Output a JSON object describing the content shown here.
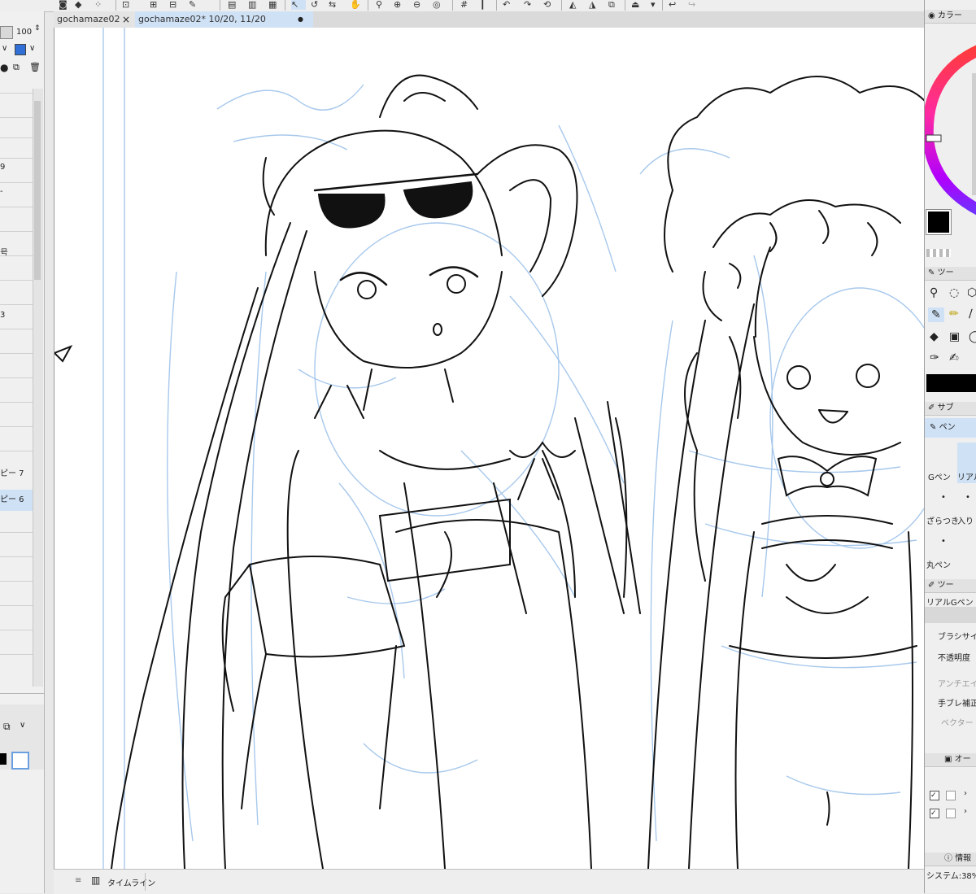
{
  "app": {
    "tabs": [
      {
        "label": "gochamaze02",
        "active": false
      },
      {
        "label": "gochamaze02* 10/20, 11/20",
        "active": true
      }
    ],
    "tab_close_glyph": "×",
    "tab_modified_glyph": "●"
  },
  "left_panel": {
    "opacity_value": "100",
    "layer_numbers": [
      "9",
      "3"
    ],
    "side_glyph": "号",
    "copies": [
      {
        "label": "ピー 7",
        "selected": false
      },
      {
        "label": "ピー 6",
        "selected": true
      }
    ]
  },
  "bottom_bar": {
    "timeline_label": "タイムライン"
  },
  "right_panel": {
    "color_header": "カラー",
    "tool_header": "ツー",
    "sub_header": "サブ",
    "sub_tool_selected": "ペン",
    "brushes": [
      "Gペン",
      "リアル",
      "ざらつき",
      "入り",
      "丸ペン"
    ],
    "tool_property_header": "ツー",
    "tool_name": "リアルGペン",
    "properties": [
      "ブラシサイ",
      "不透明度",
      "アンチエイ",
      "手ブレ補正",
      "ベクター"
    ],
    "auto_header": "オー",
    "info_header": "情報",
    "system_status": "システム:38%"
  },
  "colors": {
    "main_color": "#000000",
    "sub_color": "#ffffff",
    "accent": "#cfe1f5",
    "sketch_line": "#9ec3ea"
  }
}
